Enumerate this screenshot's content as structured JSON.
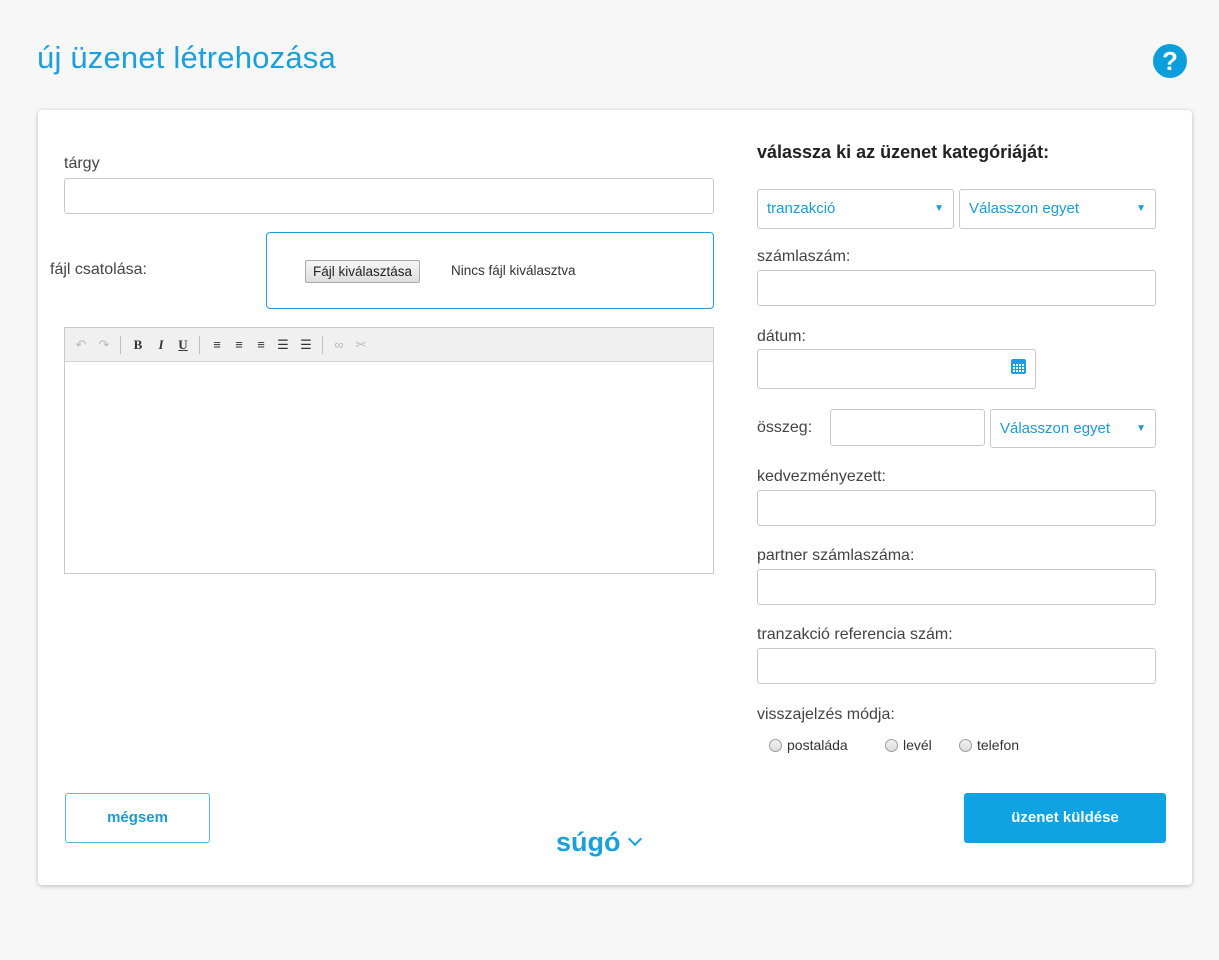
{
  "page": {
    "title": "új üzenet létrehozása",
    "help_icon": "?"
  },
  "subject": {
    "label": "tárgy",
    "value": ""
  },
  "attachment": {
    "label": "fájl csatolása:",
    "button_label": "Fájl kiválasztása",
    "status": "Nincs fájl kiválasztva"
  },
  "editor": {
    "toolbar": {
      "undo": "↶",
      "redo": "↷",
      "bold": "B",
      "italic": "I",
      "underline": "U",
      "align_left": "≡",
      "align_center": "≡",
      "justify": "≡",
      "bullet_list": "☰",
      "numbered_list": "☰",
      "link": "∞",
      "unlink": "✂"
    },
    "content": ""
  },
  "category": {
    "title": "válassza ki az üzenet kategóriáját:",
    "type_select": "tranzakció",
    "subtype_select": "Válasszon egyet"
  },
  "fields": {
    "account_number": {
      "label": "számlaszám:",
      "value": ""
    },
    "date": {
      "label": "dátum:",
      "value": ""
    },
    "amount": {
      "label": "összeg:",
      "value": "",
      "currency_select": "Válasszon egyet"
    },
    "beneficiary": {
      "label": "kedvezményezett:",
      "value": ""
    },
    "partner_account": {
      "label": "partner számlaszáma:",
      "value": ""
    },
    "transaction_reference": {
      "label": "tranzakció referencia szám:",
      "value": ""
    }
  },
  "feedback": {
    "label": "visszajelzés módja:",
    "options": [
      "postaláda",
      "levél",
      "telefon"
    ]
  },
  "buttons": {
    "cancel": "mégsem",
    "send": "üzenet küldése"
  },
  "footer": {
    "help": "súgó"
  },
  "colors": {
    "accent": "#1aa0dc",
    "primary_button": "#0fa3e3"
  },
  "icons": {
    "select_caret": "▼"
  }
}
